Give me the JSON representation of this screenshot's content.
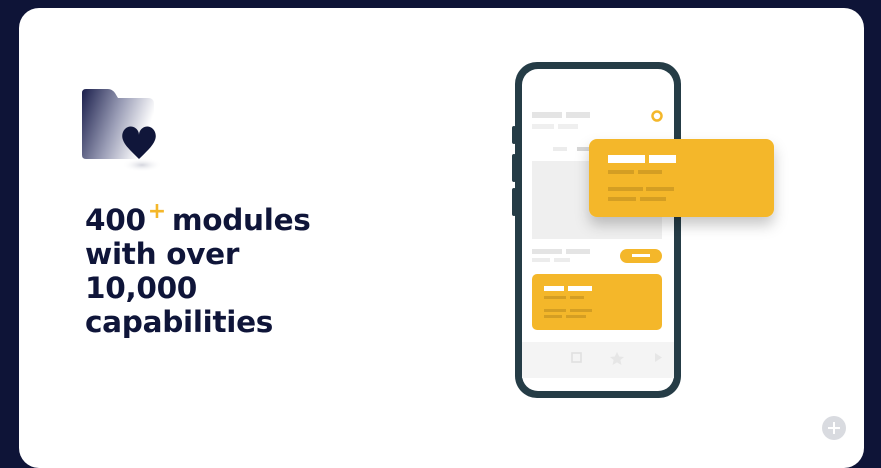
{
  "hero": {
    "count": "400",
    "count_suffix": "+",
    "line1_rest": "modules",
    "line2": "with over",
    "line3": "10,000",
    "line4": "capabilities"
  },
  "colors": {
    "background": "#0e1437",
    "card": "#ffffff",
    "navy_text": "#0f1539",
    "accent_yellow": "#f4b72a",
    "placeholder_gray": "#e4e4e4"
  },
  "icons": {
    "hero_icon": "folder-heart-icon",
    "corner_button": "plus-icon"
  }
}
